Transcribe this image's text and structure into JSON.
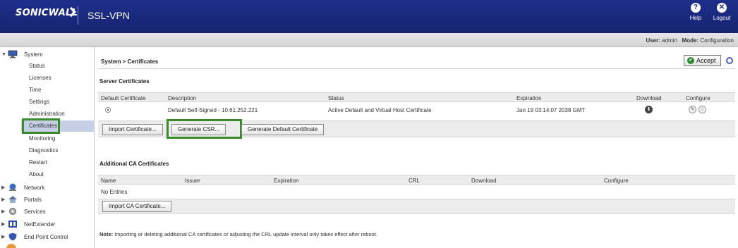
{
  "header": {
    "logo_text": "SONICWALL",
    "app_title": "SSL-VPN",
    "help_label": "Help",
    "logout_label": "Logout",
    "colors": {
      "header_bg": "#1e2f8c",
      "highlight_box": "#3a8a2a"
    }
  },
  "userbar": {
    "user_label": "User:",
    "user_value": "admin",
    "mode_label": "Mode:",
    "mode_value": "Configuration"
  },
  "sidebar": {
    "system": {
      "label": "System",
      "icon": "computer-icon",
      "items": [
        "Status",
        "Licenses",
        "Time",
        "Settings",
        "Administration",
        "Certificates",
        "Monitoring",
        "Diagnostics",
        "Restart",
        "About"
      ]
    },
    "top_items": [
      {
        "label": "Network",
        "icon": "network-icon"
      },
      {
        "label": "Portals",
        "icon": "portal-icon"
      },
      {
        "label": "Services",
        "icon": "services-icon"
      },
      {
        "label": "NetExtender",
        "icon": "netextender-icon"
      },
      {
        "label": "End Point Control",
        "icon": "shield-icon"
      }
    ]
  },
  "main": {
    "breadcrumb": "System > Certificates",
    "accept_label": "Accept",
    "server_certs": {
      "title": "Server Certificates",
      "columns": [
        "Default Certificate",
        "Description",
        "Status",
        "Expiration",
        "Download",
        "Configure"
      ],
      "row": {
        "description": "Default Self-Signed - 10.61.252.221",
        "status": "Active Default and Virtual Host Certificate",
        "expiration": "Jan 19 03:14:07 2038 GMT"
      },
      "buttons": {
        "import": "Import Certificate...",
        "generate_csr": "Generate CSR...",
        "generate_default": "Generate Default Certificate"
      }
    },
    "ca_certs": {
      "title": "Additional CA Certificates",
      "columns": [
        "Name",
        "Issuer",
        "Expiration",
        "CRL",
        "Download",
        "Configure"
      ],
      "empty_text": "No Entries",
      "import_button": "Import CA Certificate..."
    },
    "note_label": "Note:",
    "note_text": "Importing or deleting additional CA certificates or adjusting the CRL update interval only takes effect after reboot."
  }
}
